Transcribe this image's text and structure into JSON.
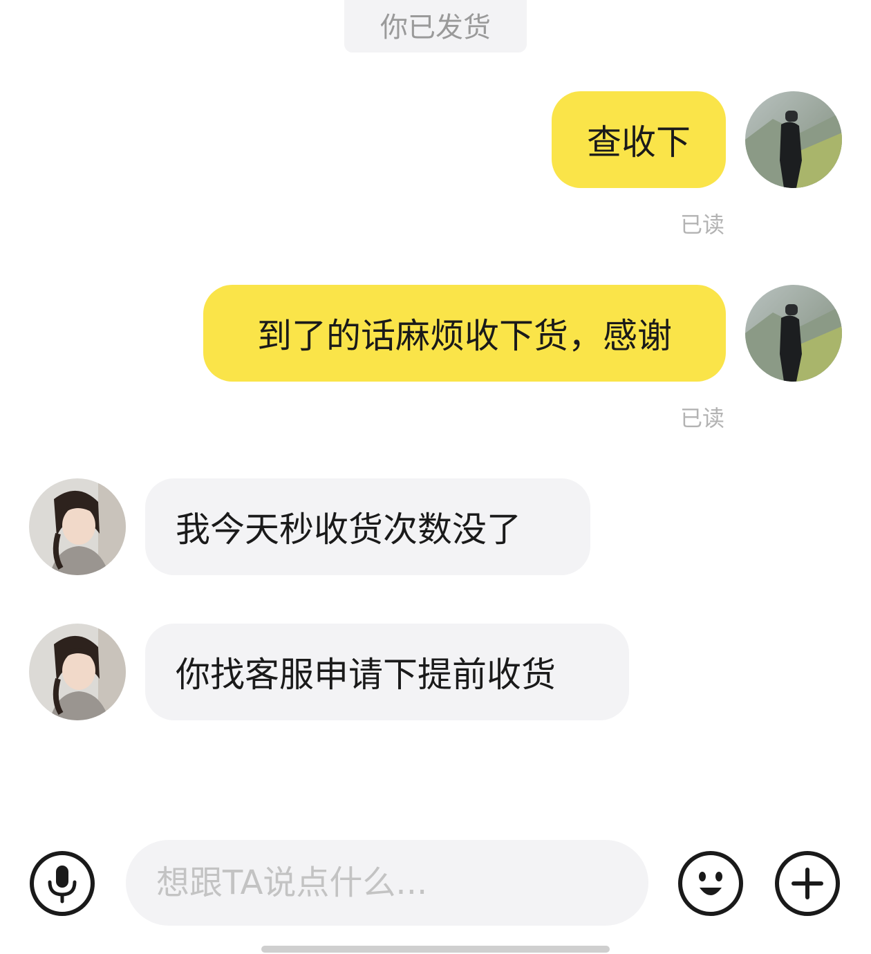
{
  "system_notice": "你已发货",
  "messages": [
    {
      "side": "mine",
      "text": "查收下",
      "status": "已读"
    },
    {
      "side": "mine",
      "text": "到了的话麻烦收下货，感谢",
      "status": "已读"
    },
    {
      "side": "theirs",
      "text": "我今天秒收货次数没了"
    },
    {
      "side": "theirs",
      "text": "你找客服申请下提前收货"
    }
  ],
  "composer": {
    "placeholder": "想跟TA说点什么...",
    "mic_icon": "microphone-icon",
    "emoji_icon": "smiley-icon",
    "plus_icon": "plus-icon"
  },
  "colors": {
    "mine_bubble": "#fae449",
    "theirs_bubble": "#f3f3f5",
    "read_status": "#b3b3b3"
  }
}
